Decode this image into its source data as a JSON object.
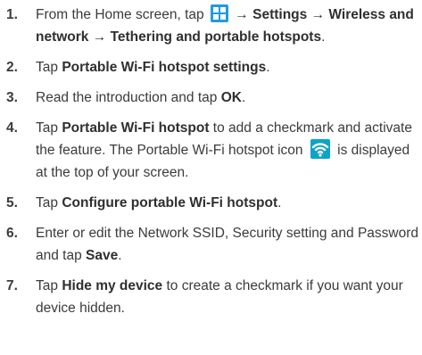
{
  "steps": [
    {
      "num": "1.",
      "prefix": "From the Home screen, tap",
      "icon": "apps-grid-icon",
      "arrow1": " → ",
      "settings": "Settings",
      "arrow2": " → ",
      "wireless": "Wireless and network",
      "arrow3": " → ",
      "tethering": "Tethering and portable hotspots",
      "end": "."
    },
    {
      "num": "2.",
      "prefix": "Tap ",
      "bold": "Portable Wi-Fi hotspot settings",
      "end": "."
    },
    {
      "num": "3.",
      "prefix": "Read the introduction and tap ",
      "bold": "OK",
      "end": "."
    },
    {
      "num": "4.",
      "prefix": "Tap ",
      "bold": "Portable Wi-Fi hotspot",
      "middle": " to add a checkmark and activate the feature. The Portable Wi-Fi hotspot icon",
      "icon": "wifi-hotspot-icon",
      "end": "is displayed at the top of your screen."
    },
    {
      "num": "5.",
      "prefix": "Tap ",
      "bold": "Configure portable Wi-Fi hotspot",
      "end": "."
    },
    {
      "num": "6.",
      "prefix": "Enter or edit the Network SSID, Security setting and Password and tap ",
      "bold": "Save",
      "end": "."
    },
    {
      "num": "7.",
      "prefix": "Tap ",
      "bold": "Hide my device",
      "end": " to create a checkmark if you want your device hidden."
    }
  ],
  "colors": {
    "text": "#3b3b3b",
    "apps_icon": "#1f9be0",
    "hotspot_icon": "#0fa3c9"
  }
}
